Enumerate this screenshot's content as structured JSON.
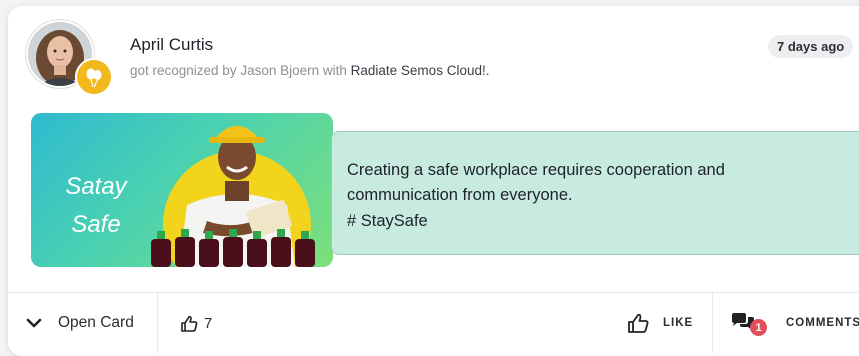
{
  "post": {
    "author": "April Curtis",
    "recognition_prefix": "got recognized by Jason Bjoern with ",
    "app_name": "Radiate Semos Cloud!.",
    "time_ago": "7 days ago"
  },
  "card": {
    "banner_title_line1": "Satay",
    "banner_title_line2": "Safe",
    "message": "Creating a safe workplace requires cooperation and communication from everyone.",
    "hashtag": "# StaySafe"
  },
  "footer": {
    "open_card_label": "Open Card",
    "thumbs_count": "7",
    "like_label": "LIKE",
    "comments_label": "COMMENTS",
    "comments_count": "1"
  },
  "colors": {
    "badge_yellow": "#f2b91c",
    "message_bg": "#c7ebe0",
    "comment_badge_red": "#e14f5a"
  },
  "icons": {
    "badge": "balloons-icon",
    "open_card": "chevron-down-icon",
    "thumbs": "thumbs-up-icon",
    "comments": "comments-icon"
  }
}
